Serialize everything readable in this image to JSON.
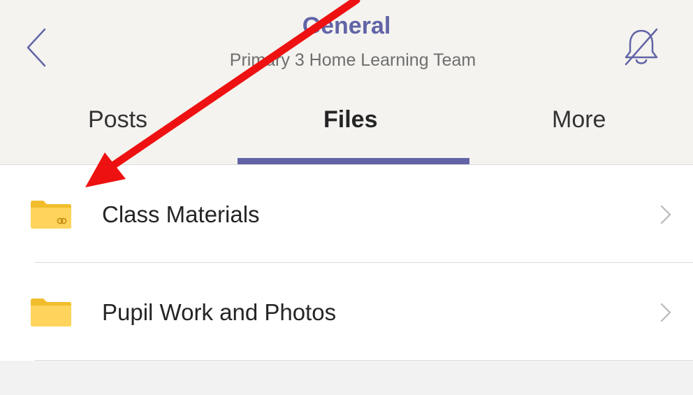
{
  "header": {
    "title": "General",
    "subtitle": "Primary 3 Home Learning Team",
    "accent_color": "#6264a7",
    "back_icon": "chevron-left-icon",
    "notifications_icon": "bell-off-icon"
  },
  "tabs": [
    {
      "label": "Posts",
      "selected": false
    },
    {
      "label": "Files",
      "selected": true
    },
    {
      "label": "More",
      "selected": false
    }
  ],
  "files": [
    {
      "name": "Class Materials",
      "icon": "shared-folder-icon"
    },
    {
      "name": "Pupil Work and Photos",
      "icon": "folder-icon"
    }
  ],
  "annotation": {
    "type": "arrow",
    "color": "#ee1111"
  }
}
